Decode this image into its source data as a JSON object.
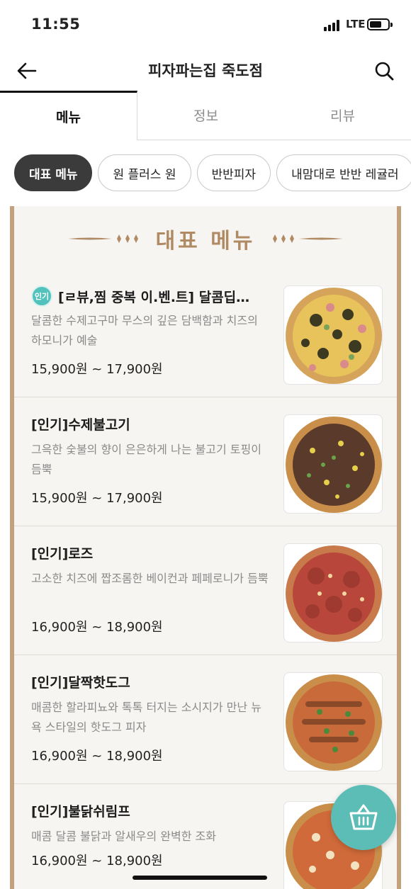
{
  "status": {
    "time": "11:55",
    "network": "LTE"
  },
  "header": {
    "title": "피자파는집 죽도점"
  },
  "tabs": [
    {
      "label": "메뉴"
    },
    {
      "label": "정보"
    },
    {
      "label": "리뷰"
    }
  ],
  "chips": [
    {
      "label": "대표 메뉴"
    },
    {
      "label": "원 플러스 원"
    },
    {
      "label": "반반피자"
    },
    {
      "label": "내맘대로 반반 레귤러"
    }
  ],
  "section": {
    "title": "대표 메뉴"
  },
  "menu": [
    {
      "badge": "인기",
      "name": "[ㄹ뷰,찜 중복 이.벤.트] 달콤딥…",
      "desc": "달콤한 수제고구마 무스의 깊은 담백함과 치즈의 하모니가 예술",
      "price": "15,900원 ~ 17,900원"
    },
    {
      "name": "[인기]수제불고기",
      "desc": "그윽한 숯불의 향이 은은하게 나는 불고기 토핑이 듬뿍",
      "price": "15,900원 ~ 17,900원"
    },
    {
      "name": "[인기]로즈",
      "desc": "고소한 치즈에 짭조롬한 베이컨과 페페로니가 듬뿍",
      "price": "16,900원 ~ 18,900원"
    },
    {
      "name": "[인기]달짝핫도그",
      "desc": "매콤한 할라피뇨와 톡톡 터지는 소시지가 만난 뉴욕 스타일의 핫도그 피자",
      "price": "16,900원 ~ 18,900원"
    },
    {
      "name": "[인기]불닭쉬림프",
      "desc": "매콤 달콤 불닭과 알새우의 완벽한 조화",
      "price": "16,900원 ~ 18,900원"
    }
  ],
  "colors": {
    "accent": "#53c2bd",
    "gold": "#b08a63",
    "chip_active": "#3b3b3b"
  }
}
